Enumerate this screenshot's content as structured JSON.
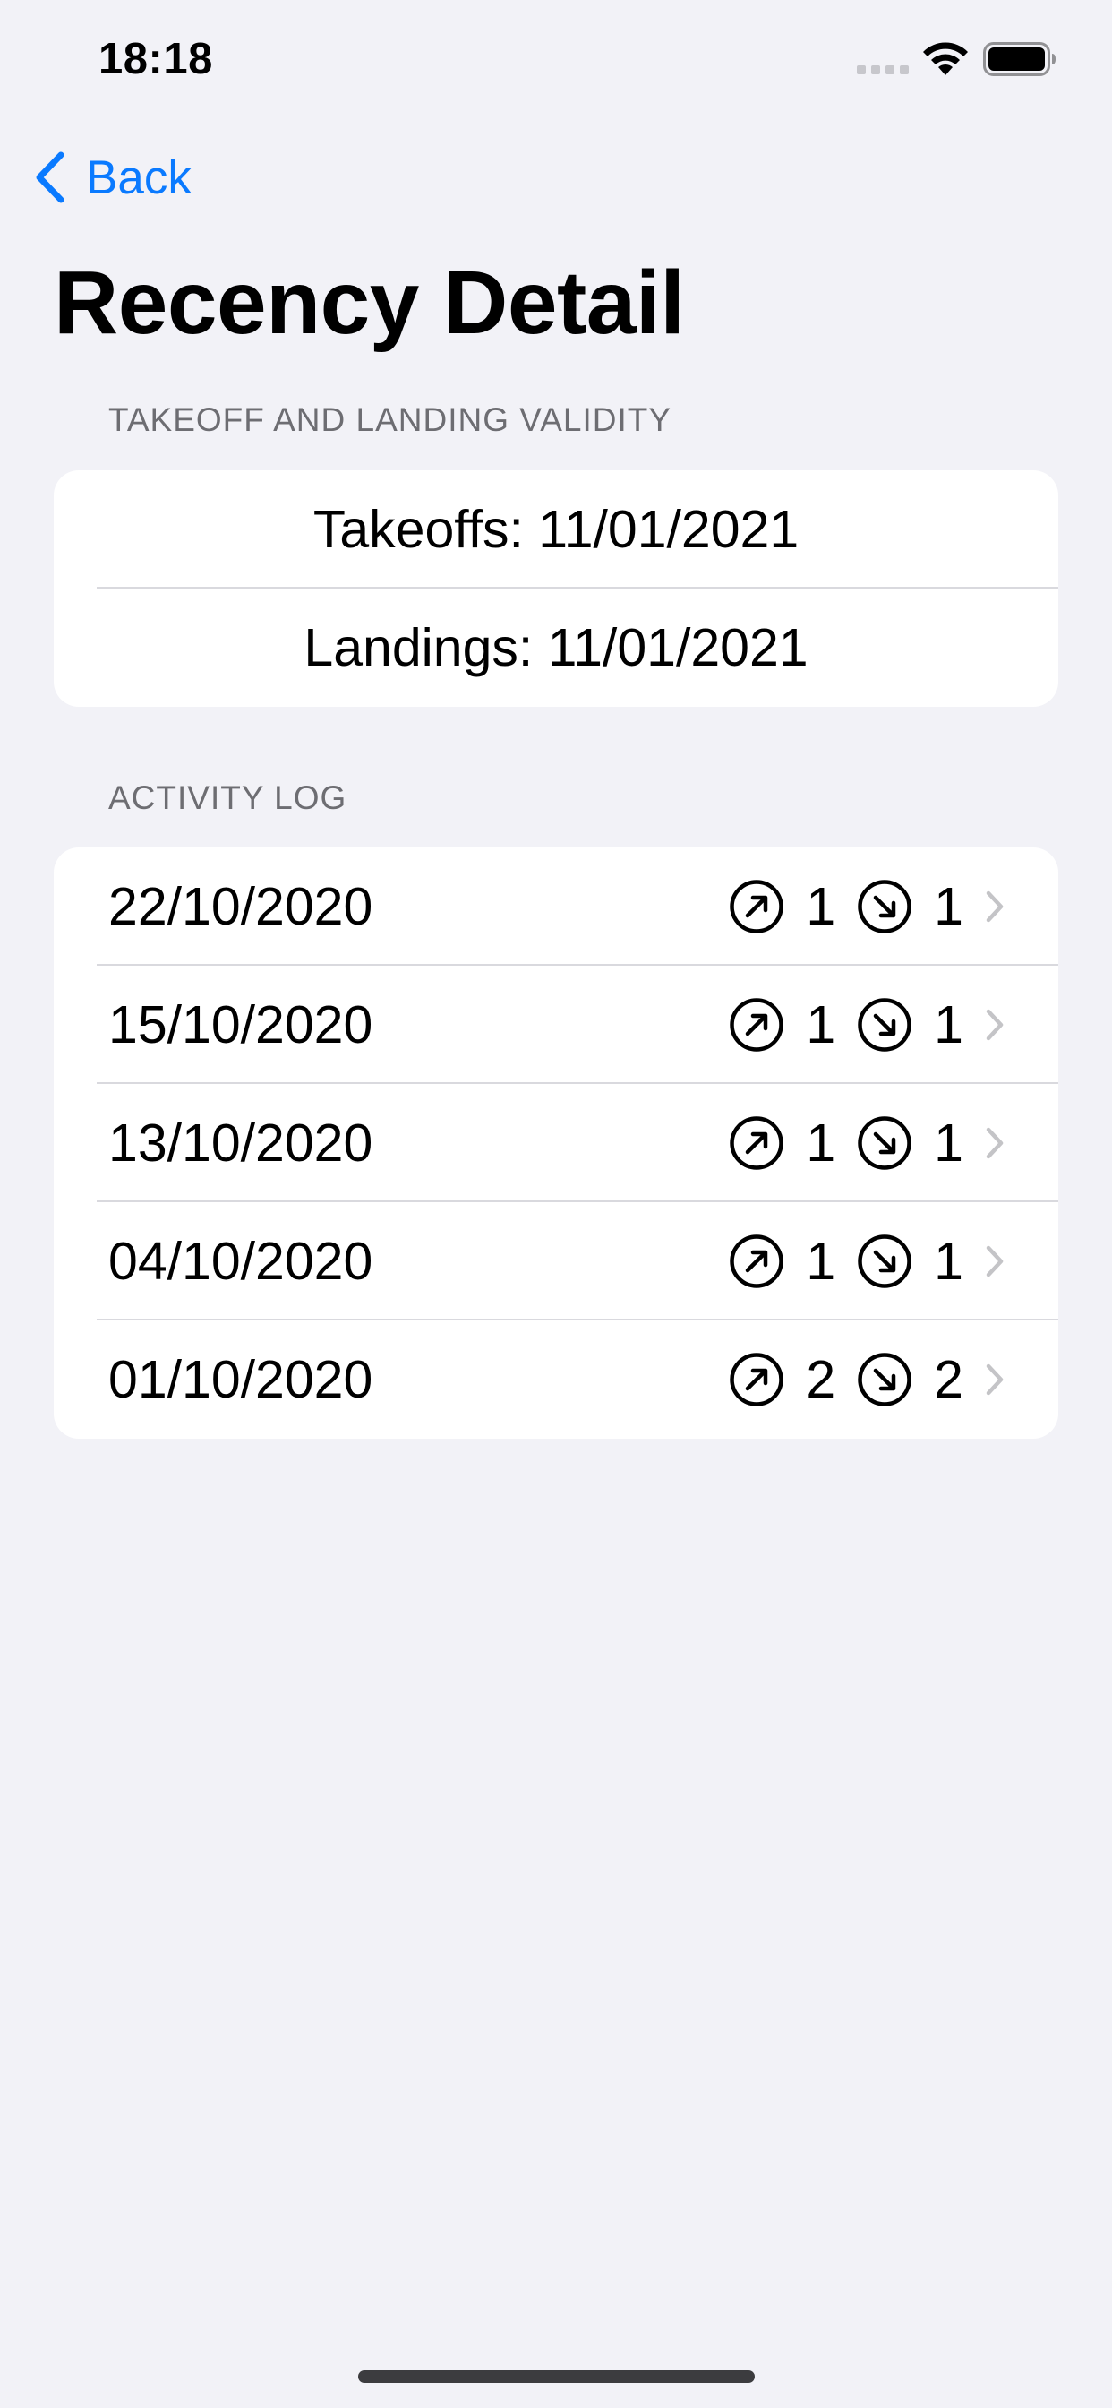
{
  "status_bar": {
    "time": "18:18"
  },
  "navigation": {
    "back_label": "Back"
  },
  "title": "Recency Detail",
  "validity_section": {
    "header": "TAKEOFF AND LANDING VALIDITY",
    "rows": [
      "Takeoffs: 11/01/2021",
      "Landings: 11/01/2021"
    ]
  },
  "activity_section": {
    "header": "ACTIVITY LOG",
    "rows": [
      {
        "date": "22/10/2020",
        "takeoffs": "1",
        "landings": "1"
      },
      {
        "date": "15/10/2020",
        "takeoffs": "1",
        "landings": "1"
      },
      {
        "date": "13/10/2020",
        "takeoffs": "1",
        "landings": "1"
      },
      {
        "date": "04/10/2020",
        "takeoffs": "1",
        "landings": "1"
      },
      {
        "date": "01/10/2020",
        "takeoffs": "2",
        "landings": "2"
      }
    ]
  },
  "icons": {
    "takeoff": "arrow-up-right-circle-icon",
    "landing": "arrow-down-right-circle-icon",
    "chevron": "chevron-right-icon",
    "back": "chevron-left-icon"
  },
  "colors": {
    "background": "#f2f2f7",
    "card": "#ffffff",
    "accent": "#0a7aff",
    "secondary_text": "#6d6d72",
    "chevron": "#c4c4c7",
    "divider": "#d9d9de"
  }
}
